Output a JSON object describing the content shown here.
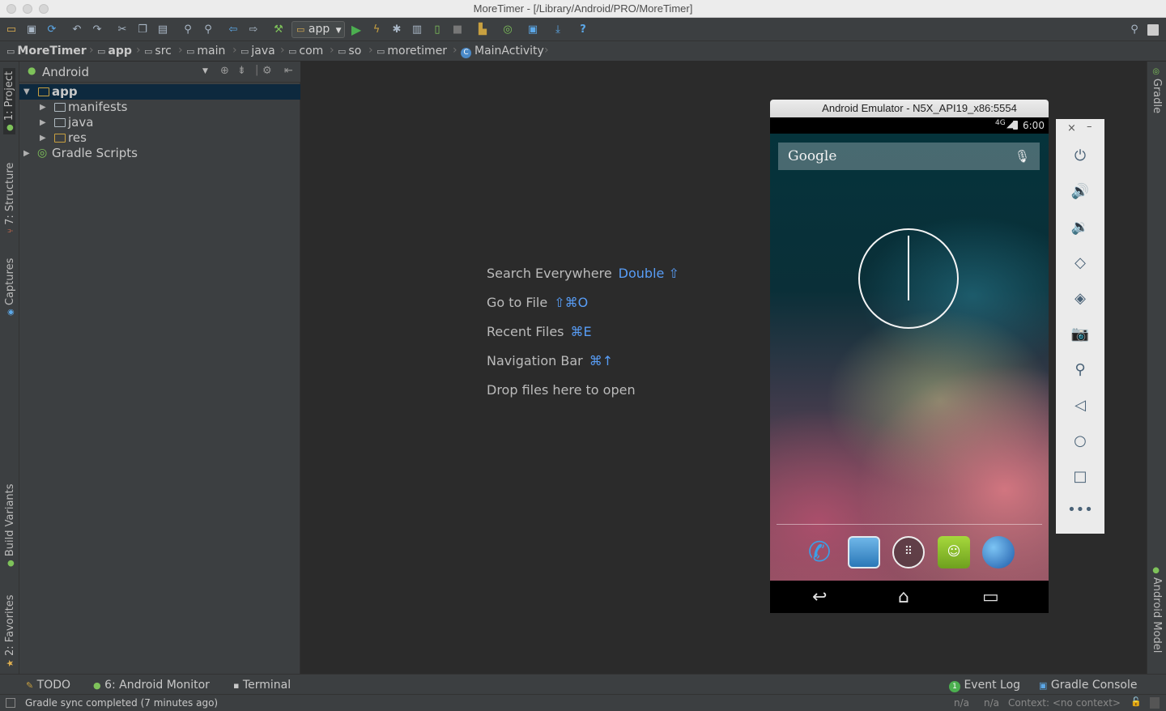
{
  "window": {
    "title": "MoreTimer - [/Library/Android/PRO/MoreTimer]"
  },
  "toolbar": {
    "run_config": "app",
    "icons": [
      "open-folder-icon",
      "save-icon",
      "sync-icon",
      "undo-icon",
      "redo-icon",
      "cut-icon",
      "copy-icon",
      "paste-icon",
      "find-icon",
      "replace-icon",
      "back-icon",
      "forward-icon",
      "make-icon",
      "run-icon",
      "apply-changes-icon",
      "debug-icon",
      "profile-icon",
      "attach-debugger-icon",
      "stop-icon",
      "avd-manager-icon",
      "gradle-sync-icon",
      "project-structure-icon",
      "sdk-manager-icon",
      "help-icon"
    ]
  },
  "breadcrumb": [
    "MoreTimer",
    "app",
    "src",
    "main",
    "java",
    "com",
    "so",
    "moretimer",
    "MainActivity"
  ],
  "left_tool_tabs": [
    "1: Project",
    "7: Structure",
    "Captures",
    "Build Variants",
    "2: Favorites"
  ],
  "right_tool_tabs": [
    "Gradle",
    "Android Model"
  ],
  "project_panel": {
    "view_mode": "Android",
    "tree": [
      {
        "label": "app",
        "level": 0,
        "expanded": true,
        "selected": true
      },
      {
        "label": "manifests",
        "level": 1,
        "expanded": false
      },
      {
        "label": "java",
        "level": 1,
        "expanded": false
      },
      {
        "label": "res",
        "level": 1,
        "expanded": false
      },
      {
        "label": "Gradle Scripts",
        "level": 0,
        "expanded": false
      }
    ]
  },
  "editor_hints": [
    {
      "text": "Search Everywhere",
      "key": "Double ⇧"
    },
    {
      "text": "Go to File",
      "key": "⇧⌘O"
    },
    {
      "text": "Recent Files",
      "key": "⌘E"
    },
    {
      "text": "Navigation Bar",
      "key": "⌘↑"
    },
    {
      "text": "Drop files here to open",
      "key": ""
    }
  ],
  "emulator": {
    "title": "Android Emulator - N5X_API19_x86:5554",
    "status_time": "6:00",
    "network_label": "4G",
    "search_label": "Google",
    "dock": [
      "phone-app-icon",
      "contacts-app-icon",
      "all-apps-icon",
      "messaging-app-icon",
      "browser-app-icon"
    ],
    "controls": [
      "power-icon",
      "volume-up-icon",
      "volume-down-icon",
      "rotate-left-icon",
      "rotate-right-icon",
      "screenshot-icon",
      "zoom-icon",
      "back-icon",
      "home-icon",
      "overview-icon",
      "more-icon"
    ]
  },
  "bottom_tabs": {
    "left": [
      {
        "label": "TODO",
        "icon": "todo-icon"
      },
      {
        "label": "6: Android Monitor",
        "icon": "android-monitor-icon"
      },
      {
        "label": "Terminal",
        "icon": "terminal-icon"
      }
    ],
    "right": [
      {
        "label": "Event Log",
        "icon": "event-log-icon",
        "badge": "1"
      },
      {
        "label": "Gradle Console",
        "icon": "gradle-console-icon"
      }
    ]
  },
  "status": {
    "message": "Gradle sync completed (7 minutes ago)",
    "position_1": "n/a",
    "position_2": "n/a",
    "context": "Context: <no context>"
  },
  "colors": {
    "accent_blue": "#589df6",
    "android_green": "#a4c639",
    "selection": "#0d293e"
  }
}
